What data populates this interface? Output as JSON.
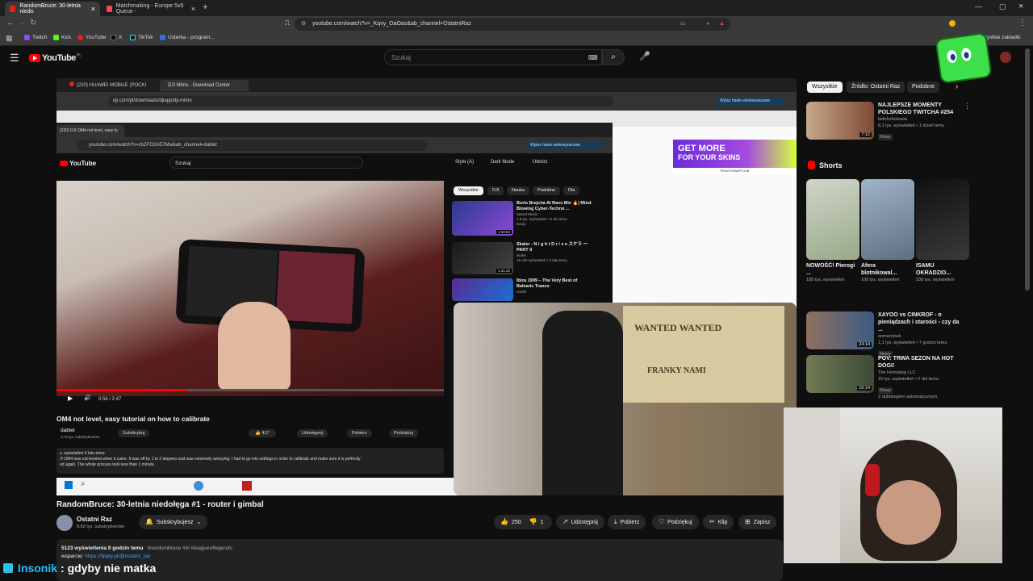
{
  "browser": {
    "tabs": [
      {
        "label": "RandomBruce: 30-letnia niedo",
        "active": true
      },
      {
        "label": "Matchmaking - Europe 5v5 Queue -",
        "active": false
      }
    ],
    "url": "youtube.com/watch?v=_Kqvy_OaOas&ab_channel=OstatniRaz",
    "bookmarks": [
      "Twitch",
      "Kick",
      "YouTube",
      "X",
      "TikTok",
      "Usterka - program..."
    ],
    "all_bookmarks": "Wszystkie zakładki"
  },
  "youtube": {
    "logo": "YouTube",
    "country": "PL",
    "search_placeholder": "Szukaj"
  },
  "inner_browser": {
    "tabs": [
      "(220) HUAWEI MOBILE (POCKI",
      "DJI Mimo - Download Center"
    ],
    "url": "dji.com/pl/downloads/djiapp/dji-mimo",
    "password_btn": "Wpisz hasło wielowyrazowe"
  },
  "inner_browser2": {
    "tab": "(220) DJI OM4 not level, easy tu",
    "url": "youtube.com/watch?v=cbZFO2AE7Mw&ab_channel=dablet",
    "password_btn": "Wpisz hasło wielowyrazowe",
    "search": "Szukaj",
    "style_label": "Style (A)",
    "dark_mode": "Dark Mode",
    "create": "Utwórz",
    "chips": [
      "Wszystkie",
      "DJI",
      "Nauka",
      "Podobne",
      "Dla"
    ],
    "recs": [
      {
        "title": "Boris Brejcha AI Rave Mix 🔥| Mind-Blowing Cyber-Techno ...",
        "channel": "Speed Music",
        "meta": "7,8 tys. wyświetleń • 6 dni temu",
        "badge": "Nowy",
        "duration": "1:53:04"
      },
      {
        "title": "Skaler - N i g h t D r i v e スケラ ー PART II",
        "channel": "skaler.",
        "meta": "15 mln wyświetleń • 3 lata temu",
        "badge": "",
        "duration": "1:31:22"
      },
      {
        "title": "Ibiza 1999 – The Very Best of Balearic Trance",
        "channel": "USSR",
        "meta": "",
        "badge": "",
        "duration": ""
      }
    ],
    "time": "0:56 / 2:47",
    "video_title": "OM4 not level, easy tutorial on how to calibrate",
    "channel": "dablet",
    "subs": "3,73 tys. subskrybentów",
    "subscribe": "Subskrybuj",
    "likes": "417",
    "share": "Udostępnij",
    "download": "Pobierz",
    "thanks": "Podziękuj",
    "desc_meta": "s. wyświetleń  4 lata temu",
    "desc1": "J! OM4 was not leveled when it came. It was off by 1 to 2 degrees and was extremely annoying. I had to go into settings in order to calibrate and make sure it is perfectly",
    "desc2": "ed again. The whole process took less than 1 minute."
  },
  "ad": {
    "line1": "GET MORE",
    "line2": "FOR YOUR SKINS",
    "brand": "PIRATESWAP.COM"
  },
  "video": {
    "title": "RandomBruce: 30-letnia niedołęga #1 - router i gimbal",
    "channel": "Ostatni Raz",
    "subs": "8,82 tys. subskrybentów",
    "subscribed": "Subskrybujesz",
    "likes": "250",
    "dislikes": "1",
    "share": "Udostępnij",
    "download": "Pobierz",
    "thanks": "Podziękuj",
    "clip": "Klip",
    "save": "Zapisz",
    "views": "5123 wyświetlenia  9 godzin temu",
    "hashtags": "#randombruce #irl #leagueoflegends",
    "support_label": "wsparcie:",
    "support_link": "https://tipply.pl/@ostatni_raz"
  },
  "sidebar": {
    "chips": [
      "Wszystkie",
      "Źródło: Ostatni Raz",
      "Podobne"
    ],
    "rec1": {
      "title": "NAJLEPSZE MOMENTY POLSKIEGO TWITCHA #254",
      "channel": "twitchshotowia",
      "meta": "8,1 tys. wyświetleń • 1 dzień temu",
      "badge": "Nowy",
      "duration": "7:12"
    },
    "shorts_label": "Shorts",
    "shorts": [
      {
        "title": "NOWOŚĆ! Pierogi ...",
        "views": "188 tys. wyświetleń"
      },
      {
        "title": "Afera blotnikowal...",
        "views": "109 tys. wyświetleń"
      },
      {
        "title": "ISAMU OKRADZIO...",
        "views": "238 tys. wyświetleń"
      }
    ],
    "rec2": {
      "title": "XAYOO vs CINKROF - o pieniądzach i starości - czy da ...",
      "channel": "oomarcinek",
      "meta": "1,1 tys. wyświetleń • 7 godzin temu",
      "badge": "Nowy",
      "duration": "24:14"
    },
    "rec3": {
      "title": "POV: TRWA SEZON NA HOT DOGI!",
      "channel": "The Homedog LLC",
      "meta": "15 tys. wyświetleń • 2 dni temu",
      "badge": "Nowy",
      "extra": "Z dubbingiem automatycznym",
      "duration": "16:14"
    }
  },
  "chat": {
    "user": "Insonik",
    "message": ": gdyby nie matka"
  },
  "overlay_text": {
    "poster": "WANTED WANTED",
    "poster2": "FRANKY  NAMI"
  }
}
